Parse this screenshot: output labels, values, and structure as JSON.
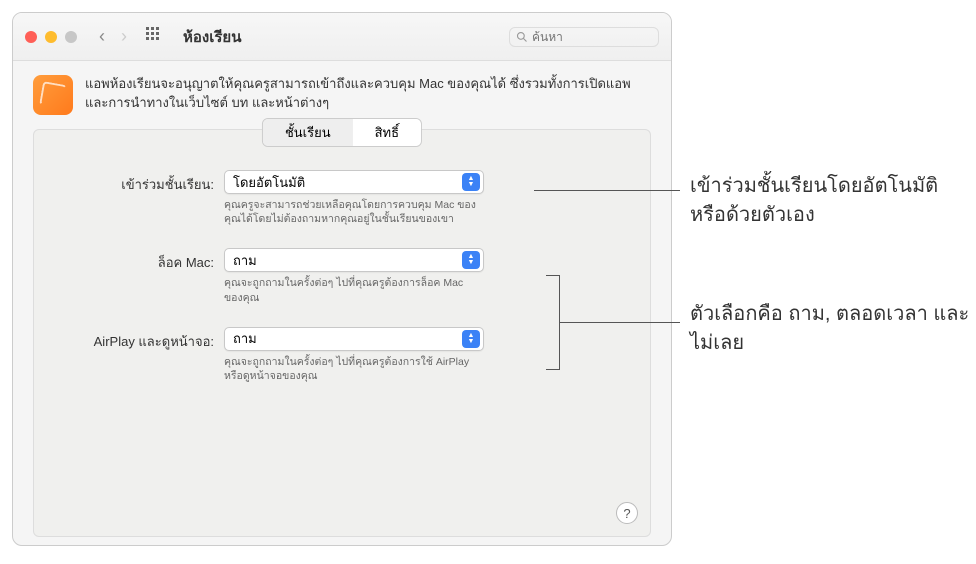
{
  "window": {
    "title": "ห้องเรียน",
    "search_placeholder": "ค้นหา"
  },
  "header": {
    "description": "แอพห้องเรียนจะอนุญาตให้คุณครูสามารถเข้าถึงและควบคุม Mac ของคุณได้ ซึ่งรวมทั้งการเปิดแอพและการนำทางในเว็บไซต์ บท และหน้าต่างๆ"
  },
  "tabs": {
    "classes": "ชั้นเรียน",
    "permissions": "สิทธิ์"
  },
  "form": {
    "join": {
      "label": "เข้าร่วมชั้นเรียน:",
      "value": "โดยอัตโนมัติ",
      "hint": "คุณครูจะสามารถช่วยเหลือคุณโดยการควบคุม Mac ของคุณได้โดยไม่ต้องถามหากคุณอยู่ในชั้นเรียนของเขา"
    },
    "lock": {
      "label": "ล็อค Mac:",
      "value": "ถาม",
      "hint": "คุณจะถูกถามในครั้งต่อๆ ไปที่คุณครูต้องการล็อค Mac ของคุณ"
    },
    "airplay": {
      "label": "AirPlay และดูหน้าจอ:",
      "value": "ถาม",
      "hint": "คุณจะถูกถามในครั้งต่อๆ ไปที่คุณครูต้องการใช้ AirPlay หรือดูหน้าจอของคุณ"
    }
  },
  "help": {
    "label": "?"
  },
  "callouts": {
    "c1": "เข้าร่วมชั้นเรียนโดยอัตโนมัติหรือด้วยตัวเอง",
    "c2": "ตัวเลือกคือ ถาม, ตลอดเวลา และไม่เลย"
  }
}
